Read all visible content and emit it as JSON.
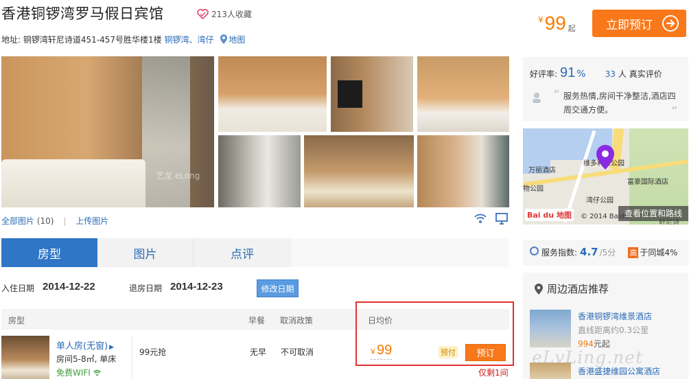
{
  "hotel": {
    "name": "香港铜锣湾罗马假日宾馆",
    "favorites": "213人收藏",
    "address_label": "地址:",
    "address": "铜锣湾轩尼诗道451-457号胜华楼1楼",
    "area1": "铜锣湾",
    "area_sep": "、",
    "area2": "湾仔",
    "map_link": "地图"
  },
  "header_price": {
    "currency": "¥",
    "value": "99",
    "suffix": "起"
  },
  "book_top_label": "立即预订",
  "photos": {
    "all_label": "全部图片",
    "count": "(10)",
    "upload_label": "上传图片",
    "watermark": "艺龙 eLong"
  },
  "reviews": {
    "rating_label": "好评率:",
    "rating_value": "91",
    "rating_unit": "%",
    "count": "33",
    "count_label": "人 真实评价",
    "quote": "服务热情,房间干净整洁,酒店四周交通方便。"
  },
  "map": {
    "labels": [
      "万丽酒店",
      "维多利亚公园",
      "富豪国际酒店",
      "湾仔公园",
      "物公园",
      "轩尼诗"
    ],
    "brand": "Bai du 地图",
    "copyright": "© 2014 Baidu",
    "route_label": "查看位置和路线"
  },
  "service": {
    "label": "服务指数:",
    "value": "4.7",
    "out_of": "/5分",
    "high_badge": "高",
    "compare": "于同城4%"
  },
  "nearby": {
    "title": "周边酒店推荐",
    "items": [
      {
        "name": "香港铜锣湾维景酒店",
        "distance": "直线距离约0.3公里",
        "price": "994",
        "price_suffix": "元起"
      },
      {
        "name": "香港盛捷维园公寓酒店"
      }
    ],
    "watermark": "eLvLing.net"
  },
  "tabs": [
    {
      "label": "房型"
    },
    {
      "label": "图片"
    },
    {
      "label": "点评"
    }
  ],
  "dates": {
    "checkin_label": "入住日期",
    "checkin": "2014-12-22",
    "checkout_label": "退房日期",
    "checkout": "2014-12-23",
    "modify_label": "修改日期"
  },
  "table": {
    "headers": {
      "room": "房型",
      "breakfast": "早餐",
      "cancel": "取消政策",
      "avg_price": "日均价"
    },
    "rows": [
      {
        "name": "单人房(无窗)",
        "details": "房间5-8㎡, 单床",
        "wifi": "免费WIFI",
        "promo": "99元抢",
        "breakfast": "无早",
        "cancel": "不可取消",
        "currency": "¥",
        "price": "99",
        "prepay": "预付",
        "book_label": "预订",
        "remaining": "仅剩1间"
      }
    ]
  },
  "colors": {
    "accent": "#f9781a",
    "link": "#2a6bb6",
    "tab_active": "#2f76c6",
    "highlight_box": "#e03030"
  }
}
